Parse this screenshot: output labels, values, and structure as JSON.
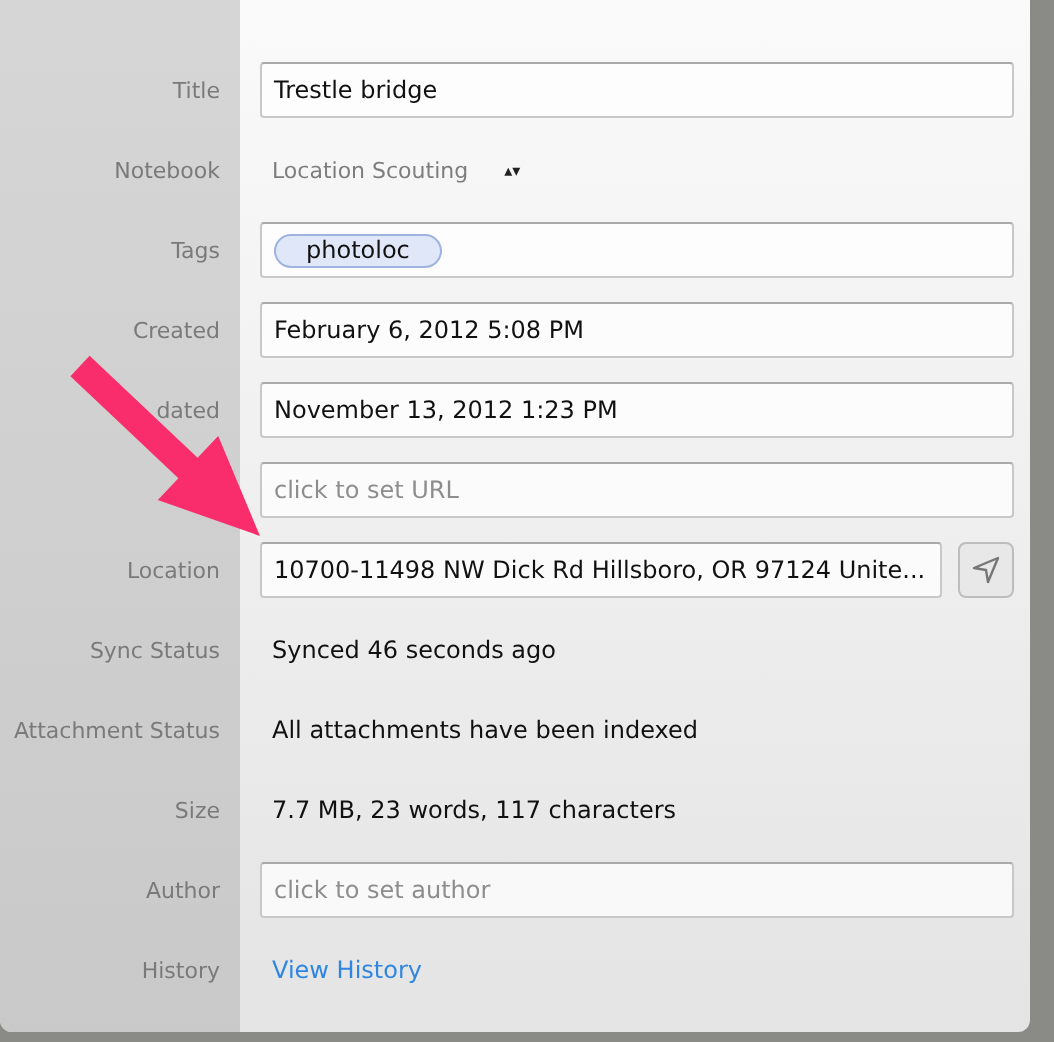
{
  "rows": [
    {
      "kind": "field",
      "label": "Title",
      "value": "Trestle bridge"
    },
    {
      "kind": "select",
      "label": "Notebook",
      "value": "Location Scouting",
      "arrows": "▴▾"
    },
    {
      "kind": "tags",
      "label": "Tags",
      "tags": [
        "photoloc"
      ]
    },
    {
      "kind": "field",
      "label": "Created",
      "value": "February 6, 2012 5:08 PM"
    },
    {
      "kind": "field",
      "label": "dated",
      "value": "November 13, 2012 1:23 PM"
    },
    {
      "kind": "field",
      "placeholder": "click to set URL"
    },
    {
      "kind": "location",
      "label": "Location",
      "value": "10700-11498 NW Dick Rd Hillsboro, OR  97124 Unite..."
    },
    {
      "kind": "text",
      "label": "Sync Status",
      "value": "Synced 46 seconds ago"
    },
    {
      "kind": "text",
      "label": "Attachment Status",
      "value": "All attachments have been indexed"
    },
    {
      "kind": "text",
      "label": "Size",
      "value": "7.7 MB, 23 words, 117 characters"
    },
    {
      "kind": "field",
      "label": "Author",
      "placeholder": "click to set author"
    },
    {
      "kind": "link",
      "label": "History",
      "value": "View History"
    }
  ]
}
